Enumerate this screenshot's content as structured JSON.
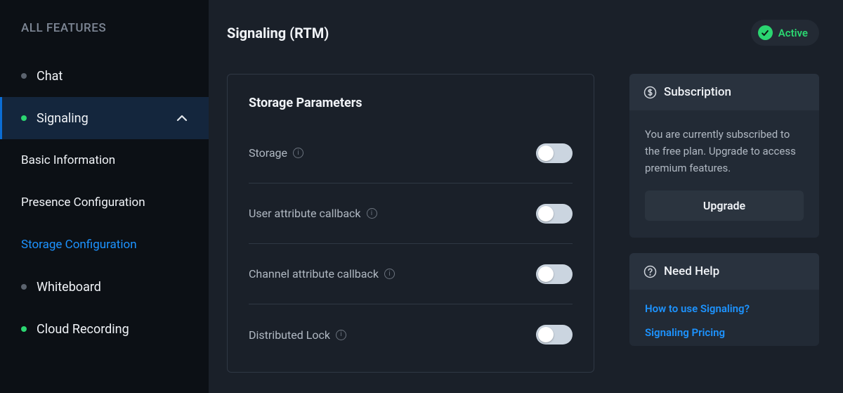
{
  "sidebar": {
    "title": "ALL FEATURES",
    "items": [
      {
        "label": "Chat",
        "dot": "gray",
        "icon": null
      },
      {
        "label": "Signaling",
        "dot": "green",
        "icon": "chevron-up",
        "active": true
      },
      {
        "label": "Whiteboard",
        "dot": "gray",
        "icon": null
      },
      {
        "label": "Cloud Recording",
        "dot": "green",
        "icon": null
      }
    ],
    "signaling_sub": [
      {
        "label": "Basic Information"
      },
      {
        "label": "Presence Configuration"
      },
      {
        "label": "Storage Configuration",
        "selected": true
      }
    ]
  },
  "header": {
    "title": "Signaling (RTM)",
    "status": {
      "text": "Active",
      "color": "#2bd671",
      "icon": "check-badge"
    }
  },
  "params": {
    "title": "Storage Parameters",
    "rows": [
      {
        "label": "Storage",
        "info": true,
        "on": false
      },
      {
        "label": "User attribute callback",
        "info": true,
        "on": false
      },
      {
        "label": "Channel attribute callback",
        "info": true,
        "on": false
      },
      {
        "label": "Distributed Lock",
        "info": true,
        "on": false
      }
    ]
  },
  "subscription": {
    "title": "Subscription",
    "icon": "dollar-circle",
    "description": "You are currently subscribed to the free plan. Upgrade to access premium features.",
    "button": "Upgrade"
  },
  "help": {
    "title": "Need Help",
    "icon": "question-circle",
    "links": [
      {
        "text": "How to use Signaling?"
      },
      {
        "text": "Signaling Pricing"
      }
    ]
  }
}
